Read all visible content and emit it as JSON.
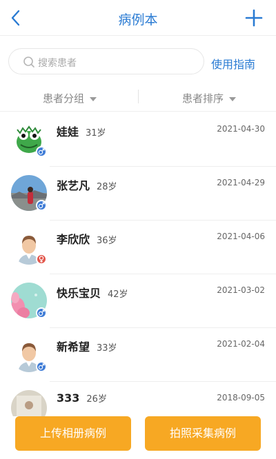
{
  "header": {
    "title": "病例本",
    "back_icon": "chevron-left-icon",
    "add_icon": "plus-icon",
    "accent": "#2a7bd3"
  },
  "search": {
    "placeholder": "搜索患者",
    "guide_label": "使用指南"
  },
  "filters": {
    "group_label": "患者分组",
    "sort_label": "患者排序"
  },
  "patients": [
    {
      "name": "娃娃",
      "age": "31岁",
      "date": "2021-04-30",
      "gender": "male",
      "avatar": "green-dinosaur-avatar"
    },
    {
      "name": "张艺凡",
      "age": "28岁",
      "date": "2021-04-29",
      "gender": "male",
      "avatar": "landscape-photo-avatar"
    },
    {
      "name": "李欣欣",
      "age": "36岁",
      "date": "2021-04-06",
      "gender": "female",
      "avatar": "default-person-avatar"
    },
    {
      "name": "快乐宝贝",
      "age": "42岁",
      "date": "2021-03-02",
      "gender": "male",
      "avatar": "pink-flowers-avatar"
    },
    {
      "name": "新希望",
      "age": "33岁",
      "date": "2021-02-04",
      "gender": "male",
      "avatar": "default-person-avatar"
    },
    {
      "name": "333",
      "age": "26岁",
      "date": "2018-09-05",
      "gender": "",
      "avatar": "photo-avatar"
    }
  ],
  "actions": {
    "upload_label": "上传相册病例",
    "capture_label": "拍照采集病例",
    "button_color": "#f7a823"
  },
  "colors": {
    "male_badge": "#3d7bd6",
    "female_badge": "#e2574c"
  }
}
